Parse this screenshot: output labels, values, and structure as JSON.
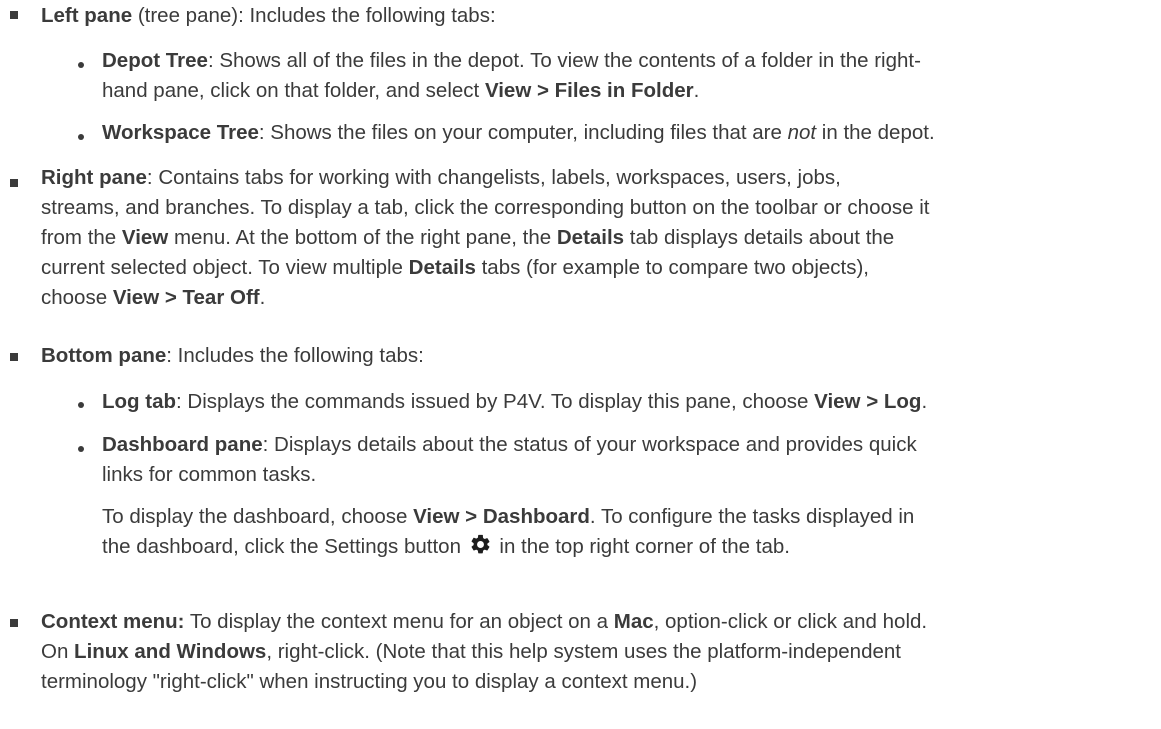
{
  "left_pane": {
    "title": "Left pane",
    "text": " (tree pane): Includes the following tabs:",
    "depot_tree": {
      "title": "Depot Tree",
      "line1": ": Shows all of the files in the depot. To view the contents of a folder in the right-",
      "line2_pre": "hand pane, click on that folder, and select ",
      "line2_bold": "View > Files in Folder",
      "line2_post": "."
    },
    "workspace_tree": {
      "title": "Workspace Tree",
      "pre": ": Shows the files on your computer, including files that are ",
      "italic": "not",
      "post": " in the depot."
    }
  },
  "right_pane": {
    "title": "Right pane",
    "line1": ": Contains tabs for working with changelists, labels, workspaces, users, jobs,",
    "line2": "streams, and branches. To display a tab, click the corresponding button on the toolbar or choose it",
    "line3_pre": "from the ",
    "line3_bold1": "View",
    "line3_mid": " menu. At the bottom of the right pane, the ",
    "line3_bold2": "Details",
    "line3_post": " tab displays details about the",
    "line4_pre": "current selected object. To view multiple ",
    "line4_bold": "Details",
    "line4_post": " tabs (for example to compare two objects),",
    "line5_pre": "choose ",
    "line5_bold": "View > Tear Off",
    "line5_post": "."
  },
  "bottom_pane": {
    "title": "Bottom pane",
    "text": ": Includes the following tabs:",
    "log_tab": {
      "title": "Log tab",
      "pre": ": Displays the commands issued by P4V. To display this pane, choose ",
      "bold": "View > Log",
      "post": "."
    },
    "dashboard_pane": {
      "title": "Dashboard pane",
      "line1": ": Displays details about the status of your workspace and provides quick",
      "line2": "links for common tasks.",
      "para2_line1_pre": "To display the dashboard, choose ",
      "para2_line1_bold": "View > Dashboard",
      "para2_line1_post": ". To configure the tasks displayed in",
      "para2_line2_pre": "the dashboard, click the Settings button ",
      "settings_icon": "gear-icon",
      "para2_line2_post": " in the top right corner of the tab."
    }
  },
  "context_menu": {
    "title": "Context menu:",
    "line1_pre": " To display the context menu for an object on a ",
    "line1_bold": "Mac",
    "line1_post": ", option-click or click and hold.",
    "line2_pre": "On ",
    "line2_bold": "Linux and Windows",
    "line2_post": ", right-click. (Note that this help system uses the platform-independent",
    "line3": "terminology \"right-click\" when instructing you to display a context menu.)"
  },
  "colors": {
    "text": "#3b3b3b",
    "bullet": "#3b3b3b",
    "background": "#ffffff"
  }
}
